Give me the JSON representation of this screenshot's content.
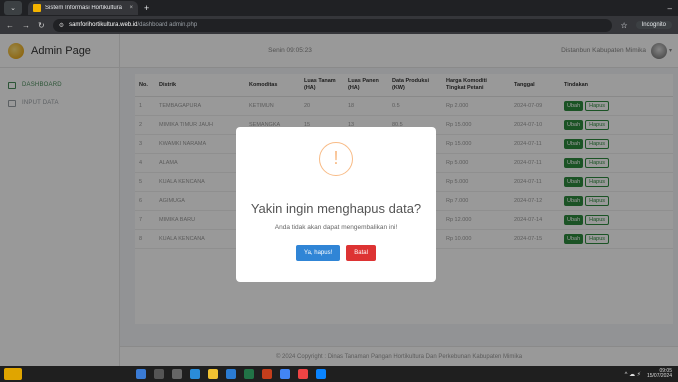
{
  "browser": {
    "tab_title": "Sistem Informasi Hortikultura",
    "url_host": "samforihortikultura.web.id",
    "url_path": "/dashboard admin.php",
    "incognito_label": "Incognito"
  },
  "sidebar": {
    "brand": "Admin Page",
    "items": [
      {
        "label": "DASHBOARD",
        "icon": "home-icon"
      },
      {
        "label": "INPUT DATA",
        "icon": "list-icon"
      }
    ]
  },
  "topbar": {
    "clock": "Senin 09:05:23",
    "user": "Distanbun Kabupaten Mimika"
  },
  "table": {
    "headers": [
      "No.",
      "Distrik",
      "Komoditas",
      "Luas Tanam (HA)",
      "Luas Panen (HA)",
      "Data Produksi (KW)",
      "Harga Komoditi Tingkat Petani",
      "Tanggal",
      "Tindakan"
    ],
    "rows": [
      {
        "no": "1",
        "distrik": "TEMBAGAPURA",
        "komoditas": "KETIMUN",
        "luas_tanam": "20",
        "luas_panen": "18",
        "produksi": "0.5",
        "harga": "Rp 2.000",
        "tanggal": "2024-07-09"
      },
      {
        "no": "2",
        "distrik": "MIMIKA TIMUR JAUH",
        "komoditas": "SEMANGKA",
        "luas_tanam": "15",
        "luas_panen": "13",
        "produksi": "80.5",
        "harga": "Rp 15.000",
        "tanggal": "2024-07-10"
      },
      {
        "no": "3",
        "distrik": "KWAMKI NARAMA",
        "komoditas": "",
        "luas_tanam": "",
        "luas_panen": "",
        "produksi": "",
        "harga": "Rp 15.000",
        "tanggal": "2024-07-11"
      },
      {
        "no": "4",
        "distrik": "ALAMA",
        "komoditas": "",
        "luas_tanam": "",
        "luas_panen": "",
        "produksi": "",
        "harga": "Rp 5.000",
        "tanggal": "2024-07-11"
      },
      {
        "no": "5",
        "distrik": "KUALA KENCANA",
        "komoditas": "",
        "luas_tanam": "",
        "luas_panen": "",
        "produksi": "",
        "harga": "Rp 5.000",
        "tanggal": "2024-07-11"
      },
      {
        "no": "6",
        "distrik": "AGIMUGA",
        "komoditas": "",
        "luas_tanam": "",
        "luas_panen": "",
        "produksi": "",
        "harga": "Rp 7.000",
        "tanggal": "2024-07-12"
      },
      {
        "no": "7",
        "distrik": "MIMIKA BARU",
        "komoditas": "",
        "luas_tanam": "",
        "luas_panen": "",
        "produksi": "",
        "harga": "Rp 12.000",
        "tanggal": "2024-07-14"
      },
      {
        "no": "8",
        "distrik": "KUALA KENCANA",
        "komoditas": "",
        "luas_tanam": "",
        "luas_panen": "",
        "produksi": "",
        "harga": "Rp 10.000",
        "tanggal": "2024-07-15"
      }
    ],
    "ubah_label": "Ubah",
    "hapus_label": "Hapus"
  },
  "footer": "© 2024 Copyright : Dinas Tanaman Pangan Hortikultura Dan Perkebunan Kabupaten Mimika",
  "modal": {
    "icon": "!",
    "title": "Yakin ingin menghapus data?",
    "text": "Anda tidak akan dapat mengembalikan ini!",
    "confirm_label": "Ya, hapus!",
    "cancel_label": "Batal"
  },
  "taskbar": {
    "time": "09:05",
    "date": "15/07/2024"
  },
  "colors": {
    "accent_green": "#2e8b3e",
    "confirm_blue": "#3085d6",
    "cancel_red": "#dd3333",
    "warning_orange": "#f8bb86"
  }
}
